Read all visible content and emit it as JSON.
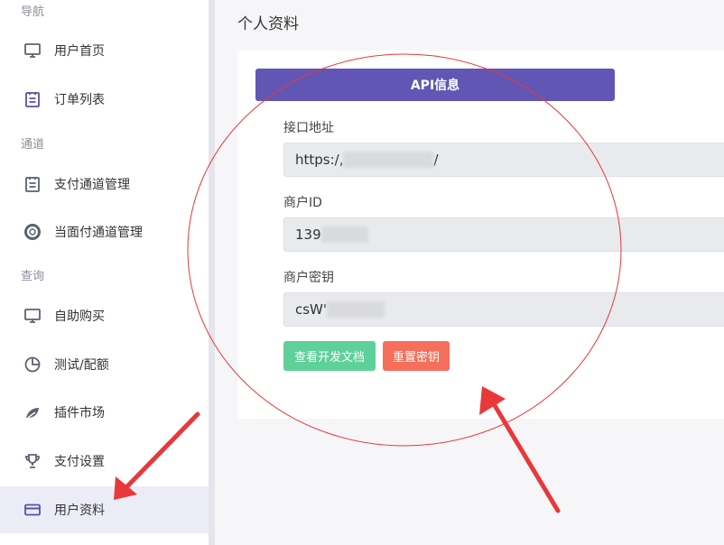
{
  "sidebar": {
    "sections": [
      {
        "title": "导航",
        "items": [
          {
            "label": "用户首页",
            "icon": "monitor-icon"
          },
          {
            "label": "订单列表",
            "icon": "clipboard-icon"
          }
        ]
      },
      {
        "title": "通道",
        "items": [
          {
            "label": "支付通道管理",
            "icon": "clipboard-icon"
          },
          {
            "label": "当面付通道管理",
            "icon": "lifebuoy-icon"
          }
        ]
      },
      {
        "title": "查询",
        "items": [
          {
            "label": "自助购买",
            "icon": "monitor-icon"
          },
          {
            "label": "测试/配额",
            "icon": "pie-chart-icon"
          },
          {
            "label": "插件市场",
            "icon": "leaf-icon"
          },
          {
            "label": "支付设置",
            "icon": "trophy-icon"
          },
          {
            "label": "用户资料",
            "icon": "credit-card-icon",
            "active": true
          }
        ]
      }
    ]
  },
  "main": {
    "title": "个人资料",
    "api_button": "API信息",
    "fields": [
      {
        "label": "接口地址",
        "value_prefix": "https:/,",
        "value_suffix": "/"
      },
      {
        "label": "商户ID",
        "value_prefix": "139",
        "value_suffix": ""
      },
      {
        "label": "商户密钥",
        "value_prefix": "csW'",
        "value_suffix": ""
      }
    ],
    "docs_button": "查看开发文档",
    "reset_button": "重置密钥"
  },
  "colors": {
    "accent": "#6156b4",
    "docs_button": "#5ed09a",
    "reset_button": "#f56f5b",
    "annotation": "#e8383a"
  }
}
